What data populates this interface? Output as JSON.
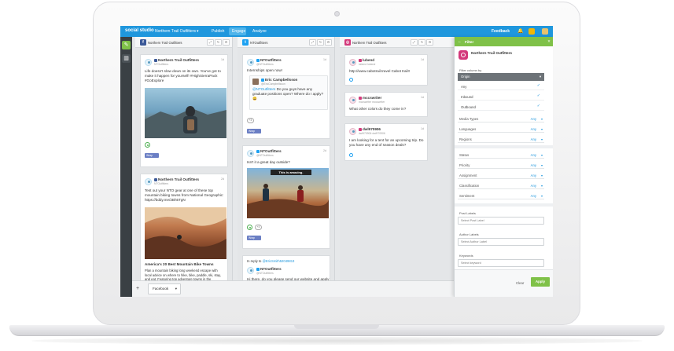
{
  "app": {
    "brand": "social studio",
    "workspace": "Northern Trail Outfitters",
    "tabs": [
      "Publish",
      "Engage",
      "Analyze"
    ],
    "active_tab": "Engage",
    "feedback": "Feedback",
    "colors": {
      "nav": "#1f97dd",
      "filter_header": "#7fc148",
      "accent_check": "#1f97dd"
    }
  },
  "columns": {
    "facebook": {
      "title": "Northern Trail Outfitters",
      "icon": "facebook-icon",
      "cards": [
        {
          "name": "Northern Trail Outfitters",
          "sub": "NTOutfitters",
          "time": "1d",
          "text": "Life doesn't slow down on its own. You've got to make it happen for yourself! #HighSierraPack #GoExplore",
          "tag": "Wrap"
        },
        {
          "name": "Northern Trail Outfitters",
          "sub": "NTOutfitters",
          "time": "2d",
          "text": "Test out your NTO gear at one of these top mountain biking towns from National Geographic: https://bddy.me/2Bh5TgN",
          "link_title": "America's 20 Best Mountain Bike Towns",
          "link_desc": "Plan a mountain biking long weekend escape with local advice on where to hike, bike, paddle, ski, stay, and eat. Featuring top adventure towns in the"
        }
      ]
    },
    "twitter": {
      "title": "NTOutfitters",
      "icon": "twitter-icon",
      "cards": [
        {
          "name": "NTOutfitters",
          "sub": "@NTOutfitters",
          "time": "1d",
          "text": "Internships open now!",
          "quote_name": "Eric Campbellsson",
          "quote_sub": "@EricCampbellsson",
          "quote_mention": "@NTOutfitters",
          "quote_text": "Do you guys have any graduate positions open? Where do I apply? 😀",
          "tag": "Wrap"
        },
        {
          "name": "NTOutfitters",
          "sub": "@NTOutfitters",
          "time": "2d",
          "text": "Isn't it a great day outside?",
          "image_caption": "This is amazing.",
          "tag": "Wrap"
        },
        {
          "reply_prefix": "In reply to",
          "reply_link": "@EricSmith52049813",
          "name": "NTOutfitters",
          "sub": "@NTOutfitters",
          "text": "Hi there, do you please send our website and apply"
        }
      ]
    },
    "instagram": {
      "title": "Northern Trail Outfitters",
      "icon": "instagram-icon",
      "cards": [
        {
          "name": "lubend",
          "sub": "lubend lubend",
          "time": "1d",
          "text": "http://www.cabotrail.travel Cabot trail!!"
        },
        {
          "name": "mccswriter",
          "sub": "mccswriter mccswriter",
          "time": "1d",
          "text": "What other colors do they come in?"
        },
        {
          "name": "dwl970906",
          "sub": "dwl970906 dwl970906",
          "time": "1d",
          "text": "I am looking for a tent for an upcoming trip. Do you have any end of season deals?"
        }
      ]
    }
  },
  "bottom": {
    "add": "+",
    "tab_label": "Facebook"
  },
  "filter": {
    "header": "Filter",
    "account_name": "Northern Trail Outfitters",
    "filter_by_label": "Filter column by",
    "select_value": "Origin",
    "options": [
      "Any",
      "Inbound",
      "Outbound"
    ],
    "rows_a": [
      {
        "k": "Media Types",
        "v": "Any"
      },
      {
        "k": "Languages",
        "v": "Any"
      },
      {
        "k": "Regions",
        "v": "Any"
      }
    ],
    "rows_b": [
      {
        "k": "Status",
        "v": "Any"
      },
      {
        "k": "Priority",
        "v": "Any"
      },
      {
        "k": "Assignment",
        "v": "Any"
      },
      {
        "k": "Classification",
        "v": "Any"
      },
      {
        "k": "Sentiment",
        "v": "Any"
      }
    ],
    "post_labels": "Post Labels",
    "post_labels_ph": "Select Post Label",
    "author_labels": "Author Labels",
    "author_labels_ph": "Select Author Label",
    "keywords": "Keywords",
    "keywords_ph": "Select keyword",
    "clear": "Clear",
    "apply": "Apply"
  }
}
